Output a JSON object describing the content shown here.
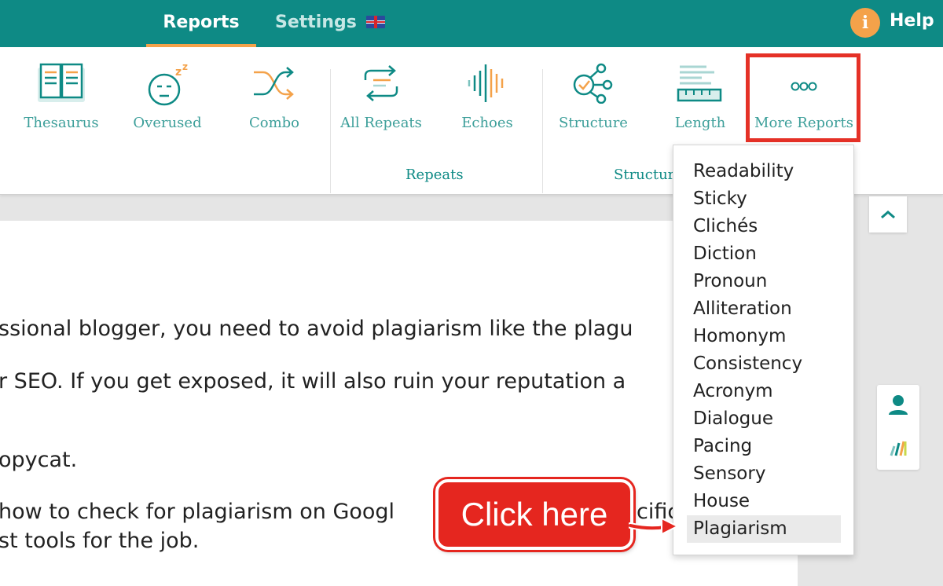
{
  "topbar": {
    "tabs": [
      {
        "label": "Reports",
        "active": true
      },
      {
        "label": "Settings",
        "active": false
      }
    ],
    "help_icon": "i",
    "help_label": "Help",
    "settings_flag": "uk-flag-icon"
  },
  "toolbar": {
    "tools": [
      {
        "label": "Thesaurus",
        "icon": "book-icon"
      },
      {
        "label": "Overused",
        "icon": "sleepy-face-icon"
      },
      {
        "label": "Combo",
        "icon": "shuffle-icon"
      },
      {
        "label": "All Repeats",
        "icon": "repeat-icon"
      },
      {
        "label": "Echoes",
        "icon": "sound-wave-icon"
      },
      {
        "label": "Structure",
        "icon": "structure-node-icon"
      },
      {
        "label": "Length",
        "icon": "ruler-lines-icon"
      },
      {
        "label": "More Reports",
        "icon": "three-dots-icon"
      }
    ],
    "groups": [
      {
        "label": "Repeats"
      },
      {
        "label": "Structur"
      }
    ]
  },
  "document": {
    "lines": [
      "ssional blogger, you need to avoid plagiarism like the plagu",
      "r SEO. If you get exposed, it will also ruin your reputation a",
      "opycat.",
      "how to check for plagiarism on Googl",
      "st tools for the job."
    ],
    "partial_fragment": "cific"
  },
  "dropdown": {
    "items": [
      "Readability",
      "Sticky",
      "Clichés",
      "Diction",
      "Pronoun",
      "Alliteration",
      "Homonym",
      "Consistency",
      "Acronym",
      "Dialogue",
      "Pacing",
      "Sensory",
      "House",
      "Plagiarism"
    ],
    "selected": "Plagiarism"
  },
  "callout": {
    "text": "Click here"
  },
  "colors": {
    "brand_teal": "#0e8a85",
    "accent_orange": "#f4a24a",
    "highlight_red": "#e53127"
  }
}
